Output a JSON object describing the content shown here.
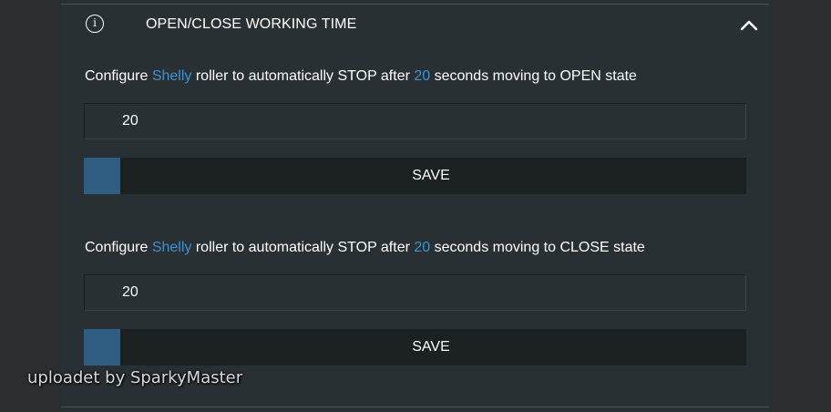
{
  "section": {
    "title": "OPEN/CLOSE WORKING TIME",
    "info_icon_glyph": "i",
    "collapse_icon": "chevron-up-icon"
  },
  "open_config": {
    "text_prefix": "Configure ",
    "device": "Shelly",
    "text_mid": " roller to automatically STOP after ",
    "seconds": "20",
    "text_suffix": " seconds moving to OPEN state",
    "input_value": "20",
    "save_label": "SAVE"
  },
  "close_config": {
    "text_prefix": "Configure ",
    "device": "Shelly",
    "text_mid": " roller to automatically STOP after ",
    "seconds": "20",
    "text_suffix": " seconds moving to CLOSE state",
    "input_value": "20",
    "save_label": "SAVE"
  },
  "watermark": "uploadet by SparkyMaster",
  "colors": {
    "background": "#2b2e31",
    "panel": "#283034",
    "highlight": "#3d93cf",
    "button": "#1b2023",
    "button_accent": "#2f5e82"
  }
}
